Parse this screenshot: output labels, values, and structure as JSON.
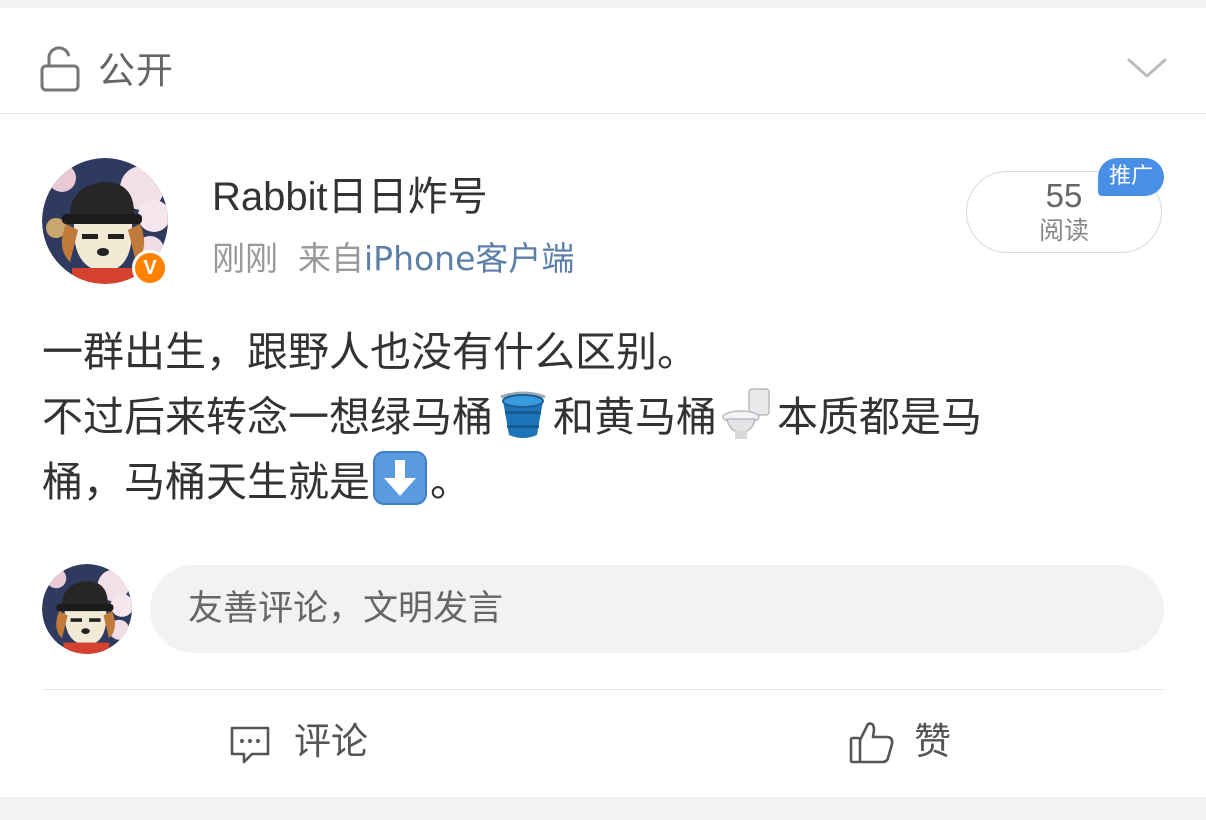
{
  "visibility": {
    "label": "公开",
    "icon": "unlock-icon",
    "expand_icon": "chevron-down-icon"
  },
  "post": {
    "author": {
      "name": "Rabbit日日炸号",
      "verified_badge": "V",
      "avatar": "cartoon-dog-avatar"
    },
    "meta": {
      "time": "刚刚",
      "source_prefix": "来自",
      "source_device": "iPhone客户端"
    },
    "reads": {
      "count": "55",
      "label": "阅读",
      "promo_tag": "推广"
    },
    "body": {
      "line1": "一群出生，跟野人也没有什么区别。",
      "line2_a": "不过后来转念一想绿马桶",
      "line2_b": "和黄马桶",
      "line2_c": "本质都是马",
      "line3_a": "桶，马桶天生就是",
      "line3_b": "。",
      "emojis": [
        "bucket-emoji",
        "toilet-emoji",
        "down-arrow-emoji"
      ]
    }
  },
  "comment_box": {
    "placeholder": "友善评论，文明发言"
  },
  "actions": {
    "comment_label": "评论",
    "like_label": "赞"
  },
  "colors": {
    "link": "#5b7fa8",
    "badge": "#ff8200",
    "promo": "#4a8fe6"
  }
}
